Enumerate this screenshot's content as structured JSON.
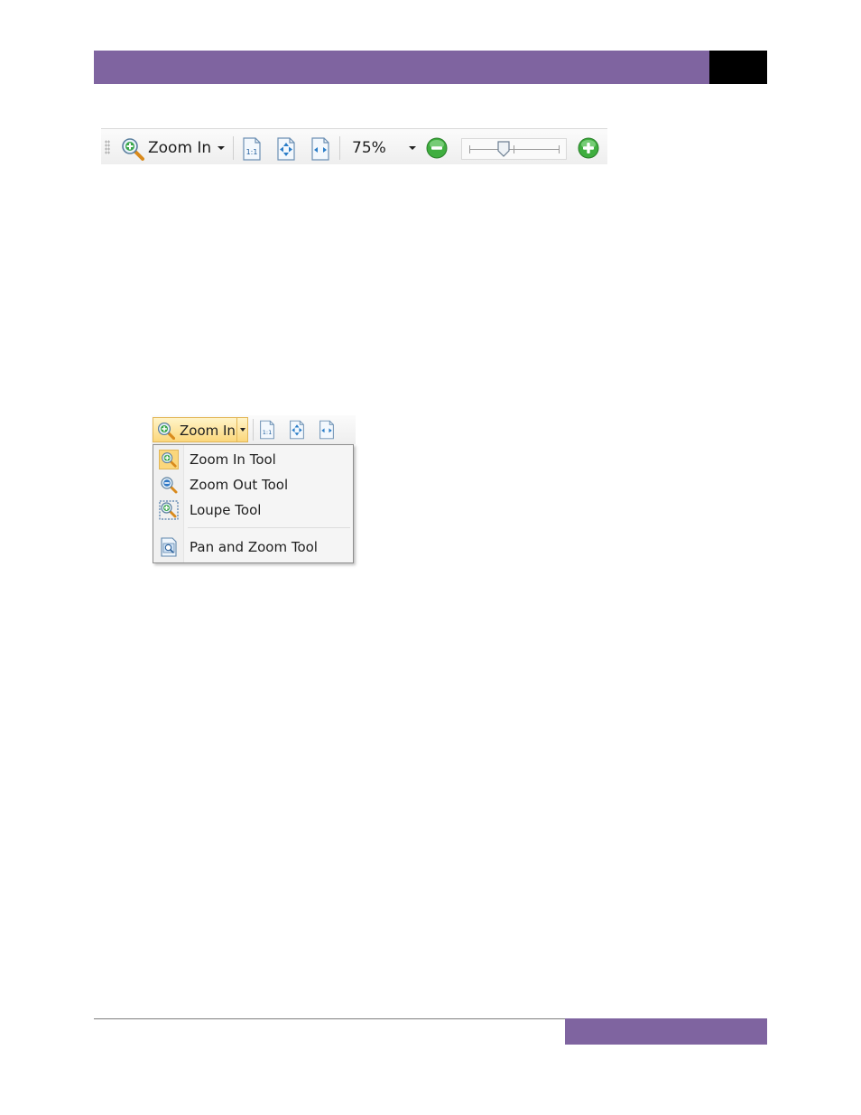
{
  "colors": {
    "accent": "#7f64a0",
    "header_box": "#000000"
  },
  "toolbar": {
    "zoom_tool_label": "Zoom In",
    "zoom_tool_icon": "zoom-in-magnifier-icon",
    "actual_size_icon": "page-actual-size-icon",
    "actual_size_text": "1:1",
    "fit_page_icon": "fit-page-icon",
    "fit_width_icon": "fit-width-icon",
    "zoom_percent": "75%",
    "zoom_out_icon": "minus-circle-icon",
    "zoom_in_icon": "plus-circle-icon",
    "zoom_slider_level": 0.38
  },
  "dropdown": {
    "button_label": "Zoom In",
    "items": [
      {
        "label": "Zoom In Tool",
        "icon": "zoom-in-icon"
      },
      {
        "label": "Zoom Out Tool",
        "icon": "zoom-out-icon"
      },
      {
        "label": "Loupe Tool",
        "icon": "loupe-icon"
      },
      {
        "label": "Pan and Zoom Tool",
        "icon": "pan-zoom-icon"
      }
    ]
  }
}
